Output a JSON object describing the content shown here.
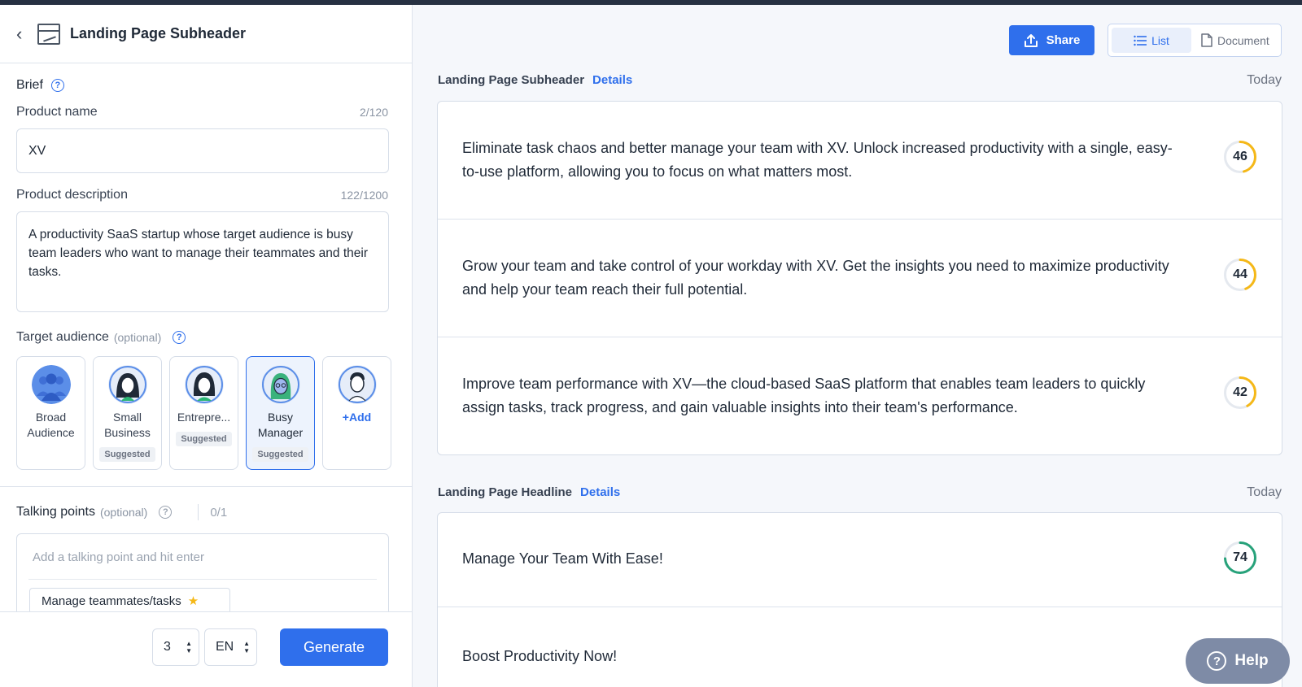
{
  "window": {
    "title": "Landing Page Subheader"
  },
  "brief": {
    "label": "Brief",
    "product_name": {
      "label": "Product name",
      "counter": "2/120",
      "value": "XV"
    },
    "product_description": {
      "label": "Product description",
      "counter": "122/1200",
      "value": "A productivity SaaS startup whose target audience is busy team leaders who want to manage their teammates and their tasks."
    }
  },
  "audience": {
    "label": "Target audience",
    "optional": "(optional)",
    "items": [
      {
        "name": "Broad Audience",
        "badge": ""
      },
      {
        "name": "Small Business",
        "badge": "Suggested"
      },
      {
        "name": "Entrepre...",
        "badge": "Suggested"
      },
      {
        "name": "Busy Manager",
        "badge": "Suggested"
      }
    ],
    "add_label": "+Add"
  },
  "talking_points": {
    "label": "Talking points",
    "optional": "(optional)",
    "count": "0/1",
    "placeholder": "Add a talking point and hit enter",
    "chip": "Manage teammates/tasks"
  },
  "footer": {
    "count_value": "3",
    "language_value": "EN",
    "generate_label": "Generate"
  },
  "toolbar": {
    "share_label": "Share",
    "list_label": "List",
    "document_label": "Document"
  },
  "sections": [
    {
      "title": "Landing Page Subheader",
      "details": "Details",
      "date": "Today",
      "results": [
        {
          "text": "Eliminate task chaos and better manage your team with XV. Unlock increased productivity with a single, easy-to-use platform, allowing you to focus on what matters most.",
          "score": 46
        },
        {
          "text": "Grow your team and take control of your workday with XV. Get the insights you need to maximize productivity and help your team reach their full potential.",
          "score": 44
        },
        {
          "text": "Improve team performance with XV—the cloud-based SaaS platform that enables team leaders to quickly assign tasks, track progress, and gain valuable insights into their team's performance.",
          "score": 42
        }
      ]
    },
    {
      "title": "Landing Page Headline",
      "details": "Details",
      "date": "Today",
      "results": [
        {
          "text": "Manage Your Team With Ease!",
          "score": 74
        },
        {
          "text": "Boost Productivity Now!",
          "score": ""
        }
      ]
    }
  ],
  "help": {
    "label": "Help"
  },
  "colors": {
    "accent": "#2f6fec",
    "score_low": "#f5b817",
    "score_high": "#27a27a"
  }
}
